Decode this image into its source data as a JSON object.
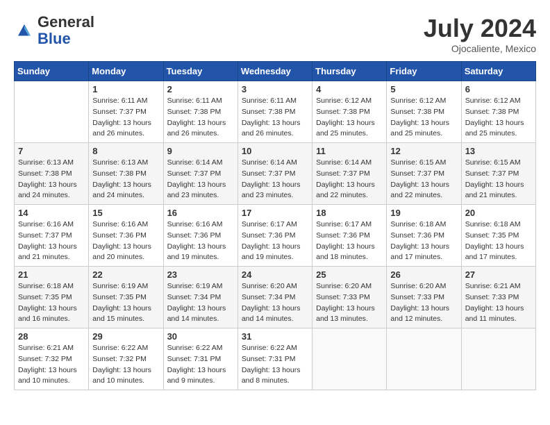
{
  "header": {
    "logo_general": "General",
    "logo_blue": "Blue",
    "month_title": "July 2024",
    "location": "Ojocaliente, Mexico"
  },
  "days_of_week": [
    "Sunday",
    "Monday",
    "Tuesday",
    "Wednesday",
    "Thursday",
    "Friday",
    "Saturday"
  ],
  "weeks": [
    [
      {
        "day": "",
        "info": ""
      },
      {
        "day": "1",
        "info": "Sunrise: 6:11 AM\nSunset: 7:37 PM\nDaylight: 13 hours\nand 26 minutes."
      },
      {
        "day": "2",
        "info": "Sunrise: 6:11 AM\nSunset: 7:38 PM\nDaylight: 13 hours\nand 26 minutes."
      },
      {
        "day": "3",
        "info": "Sunrise: 6:11 AM\nSunset: 7:38 PM\nDaylight: 13 hours\nand 26 minutes."
      },
      {
        "day": "4",
        "info": "Sunrise: 6:12 AM\nSunset: 7:38 PM\nDaylight: 13 hours\nand 25 minutes."
      },
      {
        "day": "5",
        "info": "Sunrise: 6:12 AM\nSunset: 7:38 PM\nDaylight: 13 hours\nand 25 minutes."
      },
      {
        "day": "6",
        "info": "Sunrise: 6:12 AM\nSunset: 7:38 PM\nDaylight: 13 hours\nand 25 minutes."
      }
    ],
    [
      {
        "day": "7",
        "info": "Sunrise: 6:13 AM\nSunset: 7:38 PM\nDaylight: 13 hours\nand 24 minutes."
      },
      {
        "day": "8",
        "info": "Sunrise: 6:13 AM\nSunset: 7:38 PM\nDaylight: 13 hours\nand 24 minutes."
      },
      {
        "day": "9",
        "info": "Sunrise: 6:14 AM\nSunset: 7:37 PM\nDaylight: 13 hours\nand 23 minutes."
      },
      {
        "day": "10",
        "info": "Sunrise: 6:14 AM\nSunset: 7:37 PM\nDaylight: 13 hours\nand 23 minutes."
      },
      {
        "day": "11",
        "info": "Sunrise: 6:14 AM\nSunset: 7:37 PM\nDaylight: 13 hours\nand 22 minutes."
      },
      {
        "day": "12",
        "info": "Sunrise: 6:15 AM\nSunset: 7:37 PM\nDaylight: 13 hours\nand 22 minutes."
      },
      {
        "day": "13",
        "info": "Sunrise: 6:15 AM\nSunset: 7:37 PM\nDaylight: 13 hours\nand 21 minutes."
      }
    ],
    [
      {
        "day": "14",
        "info": "Sunrise: 6:16 AM\nSunset: 7:37 PM\nDaylight: 13 hours\nand 21 minutes."
      },
      {
        "day": "15",
        "info": "Sunrise: 6:16 AM\nSunset: 7:36 PM\nDaylight: 13 hours\nand 20 minutes."
      },
      {
        "day": "16",
        "info": "Sunrise: 6:16 AM\nSunset: 7:36 PM\nDaylight: 13 hours\nand 19 minutes."
      },
      {
        "day": "17",
        "info": "Sunrise: 6:17 AM\nSunset: 7:36 PM\nDaylight: 13 hours\nand 19 minutes."
      },
      {
        "day": "18",
        "info": "Sunrise: 6:17 AM\nSunset: 7:36 PM\nDaylight: 13 hours\nand 18 minutes."
      },
      {
        "day": "19",
        "info": "Sunrise: 6:18 AM\nSunset: 7:36 PM\nDaylight: 13 hours\nand 17 minutes."
      },
      {
        "day": "20",
        "info": "Sunrise: 6:18 AM\nSunset: 7:35 PM\nDaylight: 13 hours\nand 17 minutes."
      }
    ],
    [
      {
        "day": "21",
        "info": "Sunrise: 6:18 AM\nSunset: 7:35 PM\nDaylight: 13 hours\nand 16 minutes."
      },
      {
        "day": "22",
        "info": "Sunrise: 6:19 AM\nSunset: 7:35 PM\nDaylight: 13 hours\nand 15 minutes."
      },
      {
        "day": "23",
        "info": "Sunrise: 6:19 AM\nSunset: 7:34 PM\nDaylight: 13 hours\nand 14 minutes."
      },
      {
        "day": "24",
        "info": "Sunrise: 6:20 AM\nSunset: 7:34 PM\nDaylight: 13 hours\nand 14 minutes."
      },
      {
        "day": "25",
        "info": "Sunrise: 6:20 AM\nSunset: 7:33 PM\nDaylight: 13 hours\nand 13 minutes."
      },
      {
        "day": "26",
        "info": "Sunrise: 6:20 AM\nSunset: 7:33 PM\nDaylight: 13 hours\nand 12 minutes."
      },
      {
        "day": "27",
        "info": "Sunrise: 6:21 AM\nSunset: 7:33 PM\nDaylight: 13 hours\nand 11 minutes."
      }
    ],
    [
      {
        "day": "28",
        "info": "Sunrise: 6:21 AM\nSunset: 7:32 PM\nDaylight: 13 hours\nand 10 minutes."
      },
      {
        "day": "29",
        "info": "Sunrise: 6:22 AM\nSunset: 7:32 PM\nDaylight: 13 hours\nand 10 minutes."
      },
      {
        "day": "30",
        "info": "Sunrise: 6:22 AM\nSunset: 7:31 PM\nDaylight: 13 hours\nand 9 minutes."
      },
      {
        "day": "31",
        "info": "Sunrise: 6:22 AM\nSunset: 7:31 PM\nDaylight: 13 hours\nand 8 minutes."
      },
      {
        "day": "",
        "info": ""
      },
      {
        "day": "",
        "info": ""
      },
      {
        "day": "",
        "info": ""
      }
    ]
  ]
}
